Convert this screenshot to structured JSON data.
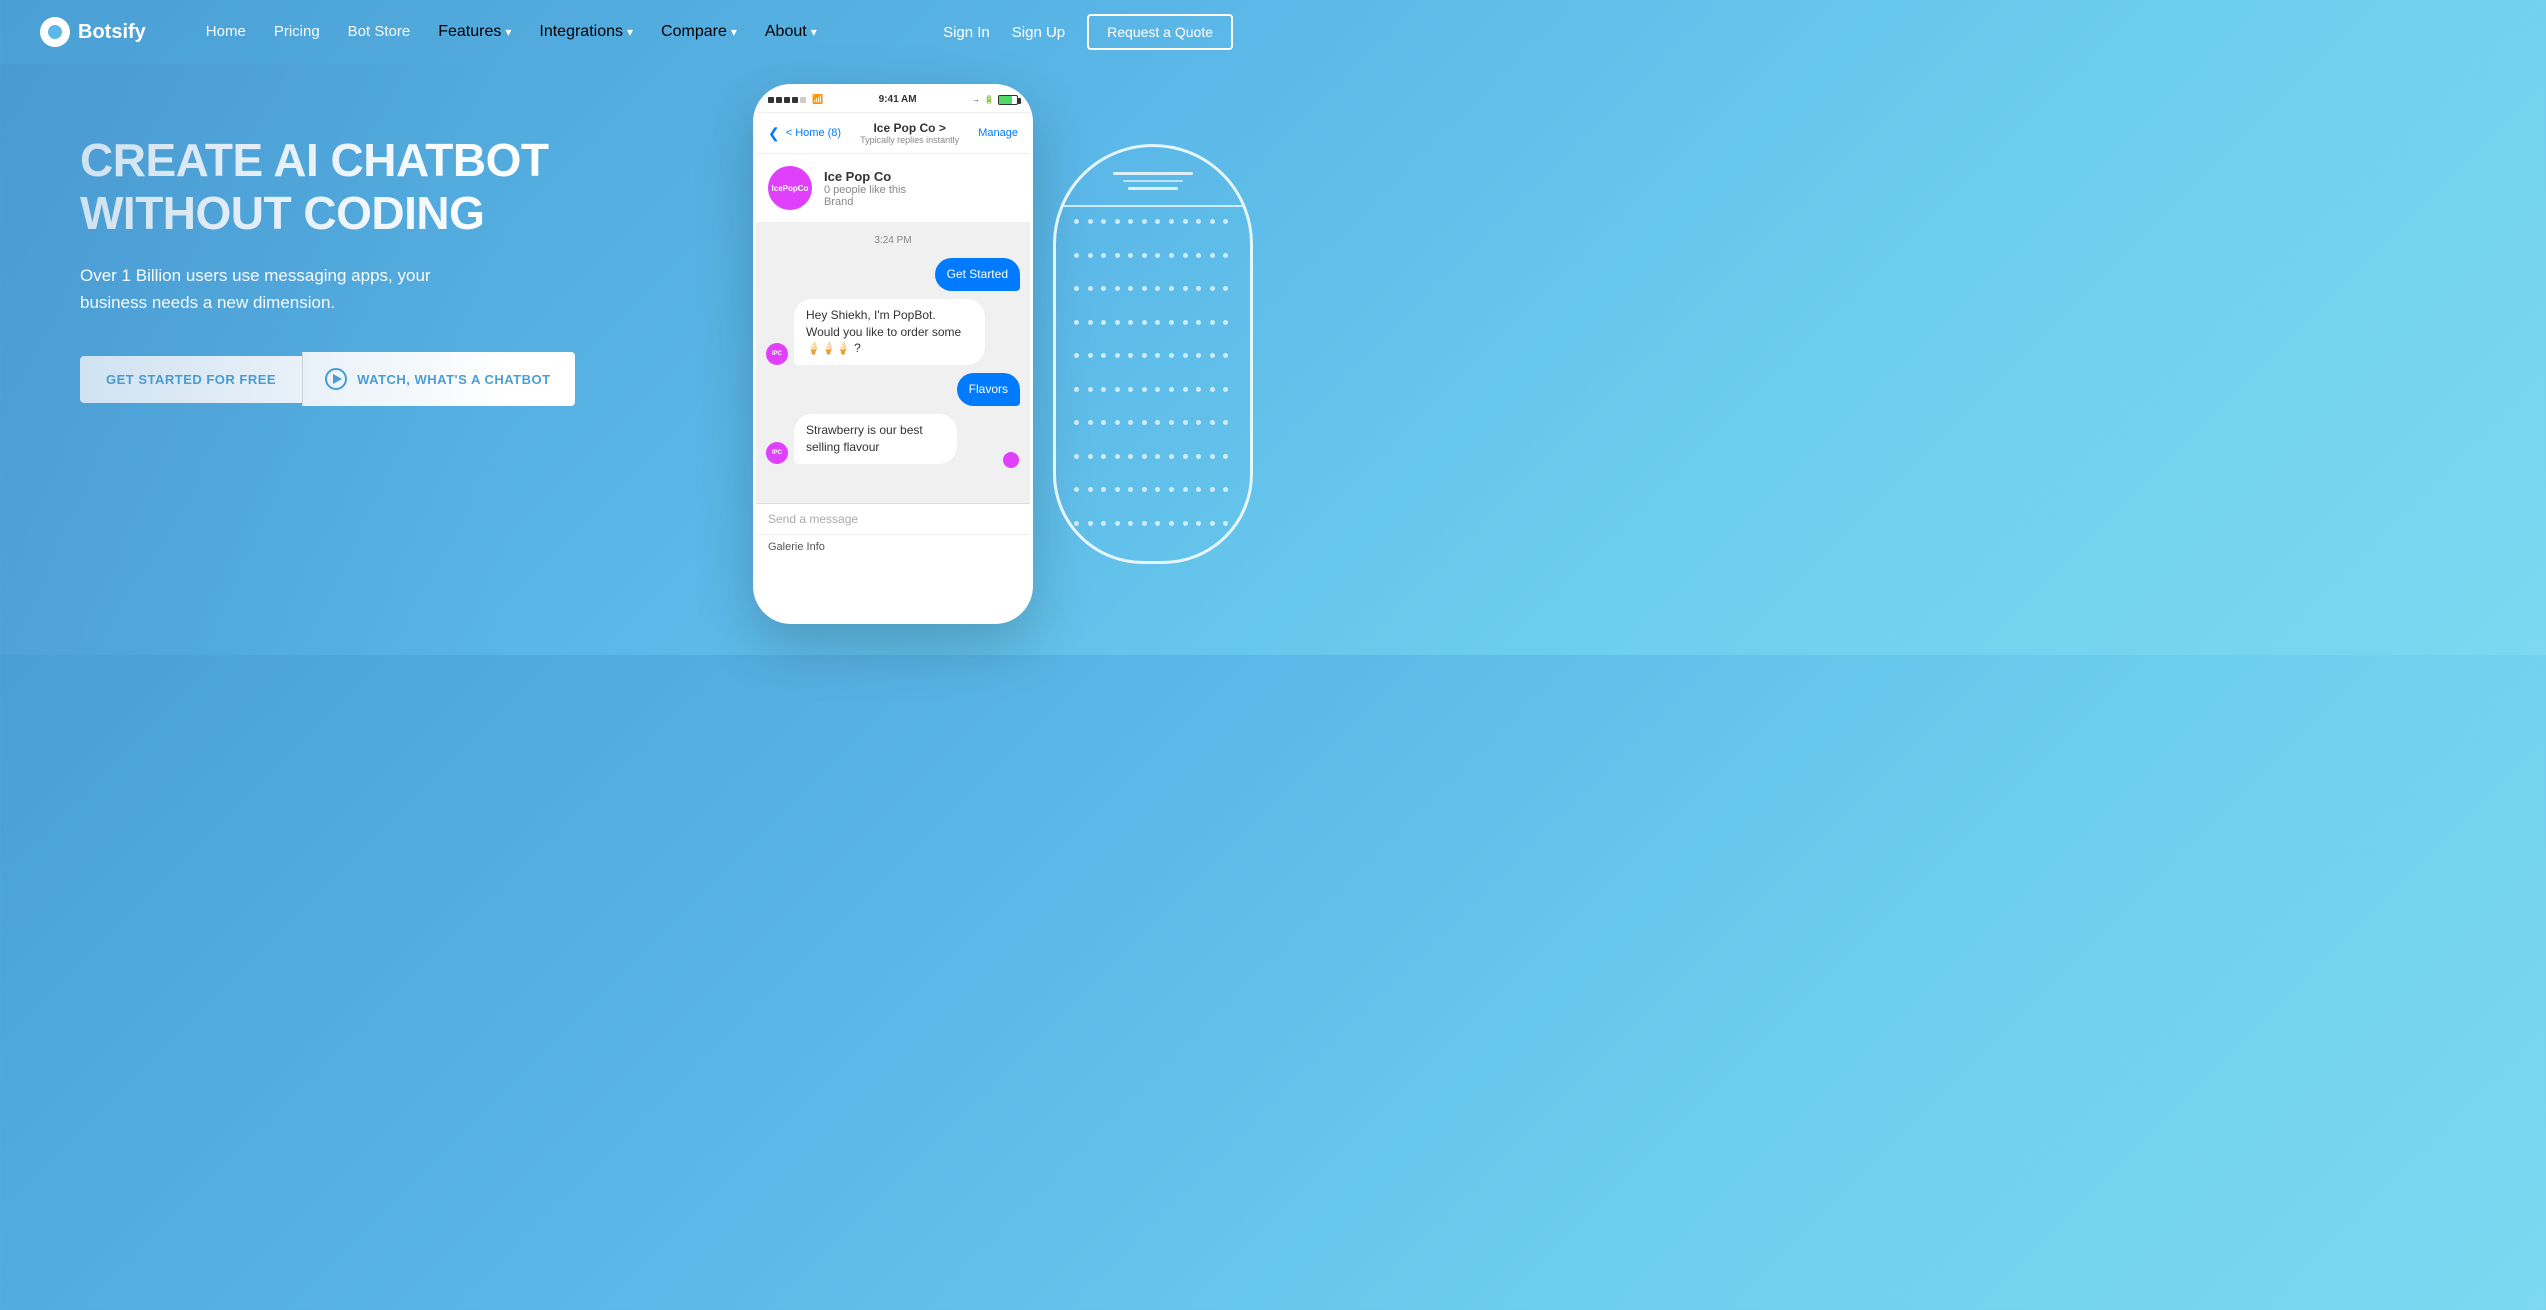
{
  "brand": {
    "name": "Botsify"
  },
  "nav": {
    "links": [
      {
        "id": "home",
        "label": "Home",
        "hasDropdown": false
      },
      {
        "id": "pricing",
        "label": "Pricing",
        "hasDropdown": false
      },
      {
        "id": "bot-store",
        "label": "Bot Store",
        "hasDropdown": false
      },
      {
        "id": "features",
        "label": "Features",
        "hasDropdown": true
      },
      {
        "id": "integrations",
        "label": "Integrations",
        "hasDropdown": true
      },
      {
        "id": "compare",
        "label": "Compare",
        "hasDropdown": true
      },
      {
        "id": "about",
        "label": "About",
        "hasDropdown": true
      }
    ],
    "auth": {
      "signin": "Sign In",
      "signup": "Sign Up",
      "quote": "Request a Quote"
    }
  },
  "hero": {
    "headline": "CREATE AI CHATBOT WITHOUT CODING",
    "subtext": "Over 1 Billion users use messaging apps, your business needs a new dimension.",
    "cta_primary": "GET STARTED FOR FREE",
    "cta_video": "WATCH, WHAT'S A CHATBOT"
  },
  "phone": {
    "status_bar": {
      "dots": [
        "●",
        "●",
        "●",
        "●",
        "●"
      ],
      "wifi": "WiFi",
      "time": "9:41 AM",
      "battery": "Battery"
    },
    "messenger_header": {
      "back": "< Home (8)",
      "page_name": "Ice Pop Co >",
      "reply_speed": "Typically replies instantly",
      "manage": "Manage"
    },
    "page_info": {
      "avatar_text": "IcePopCo",
      "name": "Ice Pop Co",
      "likes": "0 people like this",
      "type": "Brand"
    },
    "chat": {
      "timestamp": "3:24 PM",
      "messages": [
        {
          "type": "sent",
          "text": "Get Started"
        },
        {
          "type": "received",
          "text": "Hey Shiekh, I'm PopBot. Would you like to order some 🍦🍦🍦 ?"
        },
        {
          "type": "sent",
          "text": "Flavors"
        },
        {
          "type": "received",
          "text": "Strawberry is our best selling flavour"
        }
      ]
    },
    "input_placeholder": "Send a message",
    "galerie": "Galerie Info"
  },
  "colors": {
    "bg_gradient_start": "#4a9fd4",
    "bg_gradient_end": "#7dd8f0",
    "accent_blue": "#5bb8e8",
    "messenger_blue": "#007aff",
    "purple_avatar": "#e040fb"
  }
}
